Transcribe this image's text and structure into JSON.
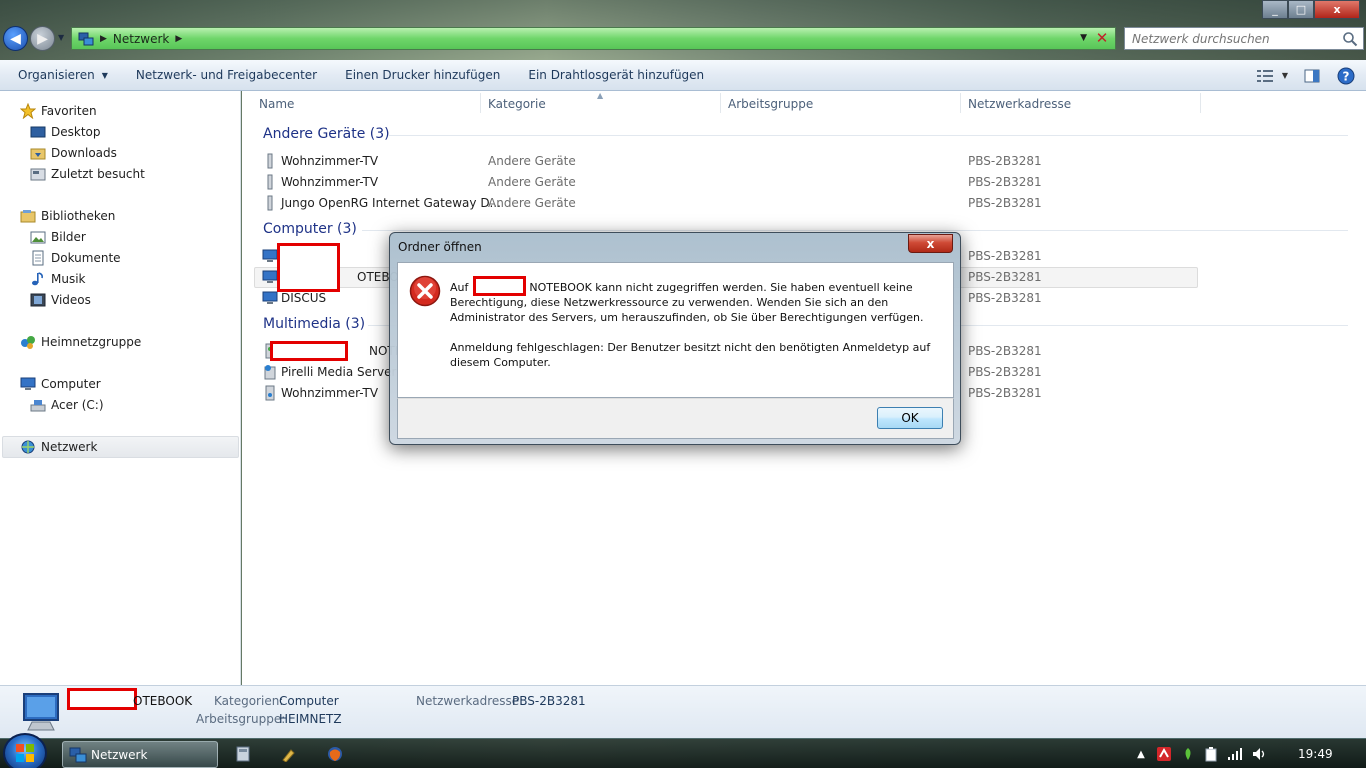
{
  "window": {
    "close_label": "x",
    "min_label": "_",
    "max_label": "□"
  },
  "address": {
    "crumb": "Netzwerk"
  },
  "search": {
    "placeholder": "Netzwerk durchsuchen"
  },
  "toolbar": {
    "organize": "Organisieren",
    "network_center": "Netzwerk- und Freigabecenter",
    "add_printer": "Einen Drucker hinzufügen",
    "add_wireless": "Ein Drahtlosgerät hinzufügen"
  },
  "nav": {
    "favorites": "Favoriten",
    "desktop": "Desktop",
    "downloads": "Downloads",
    "recent": "Zuletzt besucht",
    "libraries": "Bibliotheken",
    "pictures": "Bilder",
    "documents": "Dokumente",
    "music": "Musik",
    "videos": "Videos",
    "homegroup": "Heimnetzgruppe",
    "computer": "Computer",
    "drive_c": "Acer (C:)",
    "network": "Netzwerk"
  },
  "columns": {
    "name": "Name",
    "category": "Kategorie",
    "workgroup": "Arbeitsgruppe",
    "address": "Netzwerkadresse"
  },
  "groups": {
    "other": {
      "title": "Andere Geräte (3)"
    },
    "computer": {
      "title": "Computer (3)"
    },
    "multimedia": {
      "title": "Multimedia (3)"
    }
  },
  "rows": {
    "other": [
      {
        "name": "Wohnzimmer-TV",
        "category": "Andere Geräte",
        "address": "PBS-2B3281"
      },
      {
        "name": "Wohnzimmer-TV",
        "category": "Andere Geräte",
        "address": "PBS-2B3281"
      },
      {
        "name": "Jungo OpenRG Internet Gateway D...",
        "category": "Andere Geräte",
        "address": "PBS-2B3281"
      }
    ],
    "computer": [
      {
        "name": "",
        "address": "PBS-2B3281"
      },
      {
        "name": "OTEBOOK",
        "address": "PBS-2B3281"
      },
      {
        "name": "DISCUS",
        "address": "PBS-2B3281"
      }
    ],
    "multimedia": [
      {
        "name": "NOTEBO",
        "address": "PBS-2B3281"
      },
      {
        "name": "Pirelli Media Server",
        "address": "PBS-2B3281"
      },
      {
        "name": "Wohnzimmer-TV",
        "address": "PBS-2B3281"
      }
    ]
  },
  "details": {
    "name_suffix": "OTEBOOK",
    "categories_label": "Kategorien:",
    "categories_value": "Computer",
    "workgroup_label": "Arbeitsgruppe:",
    "workgroup_value": "HEIMNETZ",
    "address_label": "Netzwerkadresse:",
    "address_value": "PBS-2B3281"
  },
  "taskbar": {
    "task_label": "Netzwerk",
    "clock": "19:49"
  },
  "dialog": {
    "title": "Ordner öffnen",
    "close": "x",
    "msg_prefix": "Auf",
    "msg_line1_rest": "NOTEBOOK kann nicht zugegriffen werden. Sie haben eventuell keine Berechtigung, diese Netzwerkressource zu verwenden. Wenden Sie sich an den Administrator des Servers, um herauszufinden, ob Sie über Berechtigungen verfügen.",
    "msg2": "Anmeldung fehlgeschlagen: Der Benutzer besitzt nicht den benötigten Anmeldetyp auf diesem Computer.",
    "ok": "OK"
  }
}
